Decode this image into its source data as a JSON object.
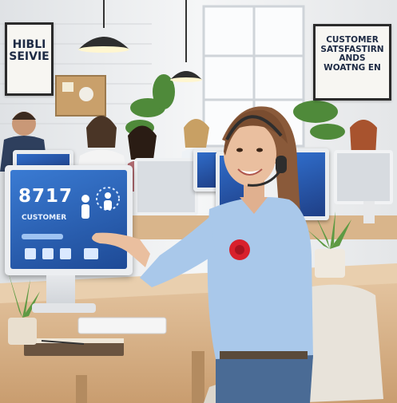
{
  "signs": {
    "left": "HIBLI\nSEIVIE",
    "right": "CUSTOMER\nSATSFASTIRN\nANDS\nWOATNG EN"
  },
  "main_monitor": {
    "number": "8717",
    "label": "CUSTOMER"
  },
  "colors": {
    "wall": "#e6e8ea",
    "desk": "#d8b48c",
    "shirt": "#a9c8ea",
    "screen_blue": "#2f6cc9",
    "flower_red": "#d8202c",
    "plant_green": "#4f8a3a"
  }
}
